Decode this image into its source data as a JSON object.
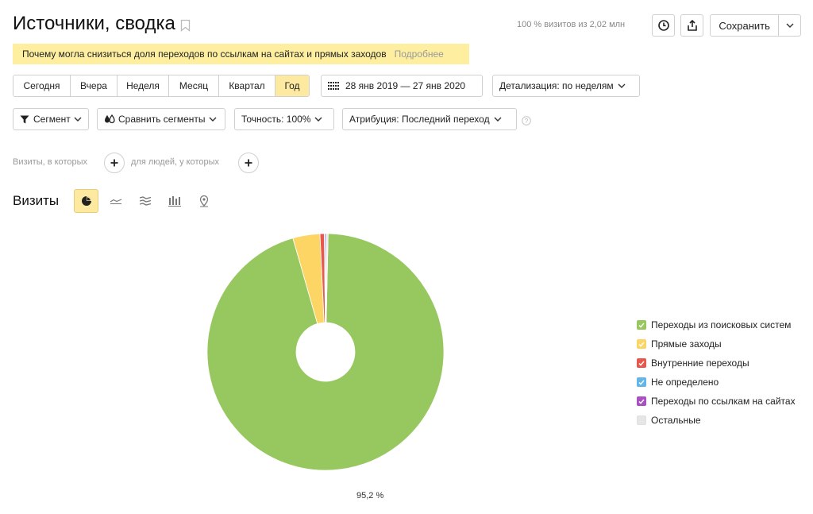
{
  "header": {
    "title": "Источники, сводка",
    "visits_summary": "100 % визитов из 2,02 млн",
    "save_label": "Сохранить"
  },
  "notice": {
    "text": "Почему могла снизиться доля переходов по ссылкам на сайтах и прямых заходов",
    "link": "Подробнее"
  },
  "periods": [
    {
      "label": "Сегодня",
      "active": false
    },
    {
      "label": "Вчера",
      "active": false
    },
    {
      "label": "Неделя",
      "active": false
    },
    {
      "label": "Месяц",
      "active": false
    },
    {
      "label": "Квартал",
      "active": false
    },
    {
      "label": "Год",
      "active": true
    }
  ],
  "date_range": "28 янв 2019 — 27 янв 2020",
  "detail": "Детализация: по неделям",
  "filters": {
    "segment": "Сегмент",
    "compare": "Сравнить сегменты",
    "accuracy": "Точность: 100%",
    "attribution": "Атрибуция: Последний переход"
  },
  "visits_builder": {
    "visits_where": "Визиты, в которых",
    "people_where": "для людей, у которых"
  },
  "section_title": "Визиты",
  "chart_types": [
    "pie-chart-icon",
    "line-chart-icon",
    "area-chart-icon",
    "bar-chart-icon",
    "map-icon"
  ],
  "colors": {
    "accent": "#fde9a0",
    "notice_bg": "#fdeea0"
  },
  "chart_data": {
    "type": "pie",
    "donut": true,
    "data_label": "95,2 %",
    "series": [
      {
        "name": "Переходы из поисковых систем",
        "value": 95.2,
        "color": "#97c85f"
      },
      {
        "name": "Прямые заходы",
        "value": 3.7,
        "color": "#fcd565"
      },
      {
        "name": "Внутренние переходы",
        "value": 0.6,
        "color": "#e8574d"
      },
      {
        "name": "Не определено",
        "value": 0.15,
        "color": "#62b6e8"
      },
      {
        "name": "Переходы по ссылкам на сайтах",
        "value": 0.15,
        "color": "#a951c2"
      },
      {
        "name": "Остальные",
        "value": 0.2,
        "color": "#e6e6e6"
      }
    ]
  }
}
